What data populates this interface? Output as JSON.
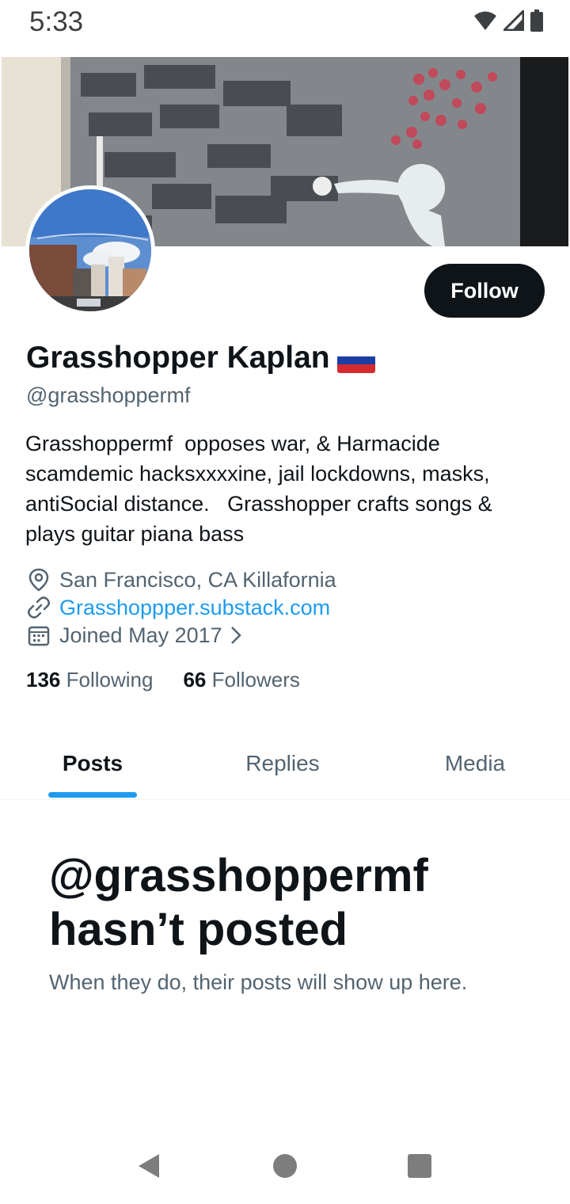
{
  "status_bar": {
    "time": "5:33",
    "icons": [
      "wifi-icon",
      "cell-signal-icon",
      "battery-icon"
    ]
  },
  "profile": {
    "name": "Grasshopper Kaplan",
    "flag_icon": "russia-flag-icon",
    "handle": "@grasshoppermf",
    "follow_label": "Follow",
    "bio": "Grasshoppermf  opposes war, & Harmacide scamdemic hacksxxxxine, jail lockdowns, masks, antiSocial distance.   Grasshopper crafts songs & plays guitar piana bass",
    "location": "San Francisco, CA Killafornia",
    "website": "Grasshoppper.substack.com",
    "joined": "Joined May 2017",
    "following_count": "136",
    "following_label": "Following",
    "followers_count": "66",
    "followers_label": "Followers"
  },
  "tabs": [
    {
      "label": "Posts",
      "active": true
    },
    {
      "label": "Replies",
      "active": false
    },
    {
      "label": "Media",
      "active": false
    }
  ],
  "empty_state": {
    "title": "@grasshoppermf hasn’t posted",
    "subtitle": "When they do, their posts will show up here."
  },
  "colors": {
    "accent": "#1d9bf0",
    "text_primary": "#0f1419",
    "text_secondary": "#536471",
    "follow_bg": "#0f1419"
  },
  "nav_bar": {
    "buttons": [
      "back-icon",
      "home-icon",
      "recents-icon"
    ]
  }
}
